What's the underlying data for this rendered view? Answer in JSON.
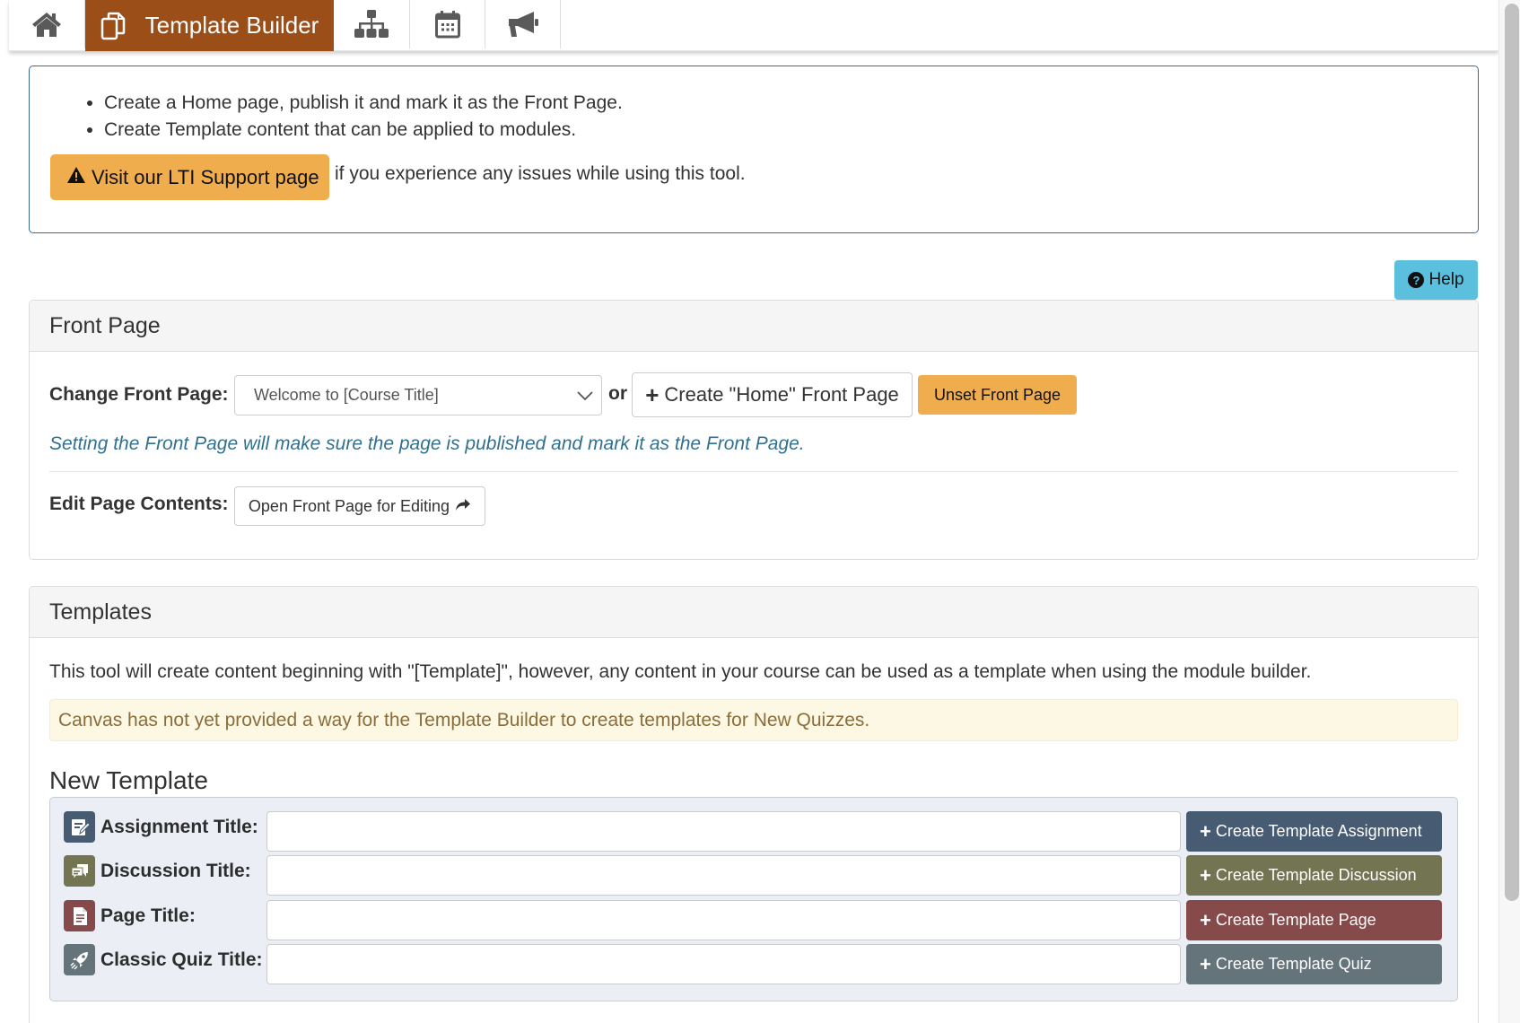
{
  "nav": {
    "tabs": [
      {
        "icon": "home-icon",
        "label": ""
      },
      {
        "icon": "copy-icon",
        "label": "Template Builder",
        "active": true
      },
      {
        "icon": "sitemap-icon",
        "label": ""
      },
      {
        "icon": "calendar-icon",
        "label": ""
      },
      {
        "icon": "bullhorn-icon",
        "label": ""
      }
    ],
    "active_color": "#9b4e18"
  },
  "info": {
    "bullets": [
      "Create a Home page, publish it and mark it as the Front Page.",
      "Create Template content that can be applied to modules."
    ],
    "support_button": "Visit our LTI Support page",
    "support_tail": "if you experience any issues while using this tool."
  },
  "help_button": "Help",
  "front_page": {
    "title": "Front Page",
    "change_label": "Change Front Page:",
    "select_value": "Welcome to [Course Title]",
    "or_text": "or",
    "create_home_button": "Create \"Home\" Front Page",
    "unset_button": "Unset Front Page",
    "note": "Setting the Front Page will make sure the page is published and mark it as the Front Page.",
    "edit_label": "Edit Page Contents:",
    "open_edit_button": "Open Front Page for Editing"
  },
  "templates": {
    "title": "Templates",
    "description": "This tool will create content beginning with \"[Template]\", however, any content in your course can be used as a template when using the module builder.",
    "warning": "Canvas has not yet provided a way for the Template Builder to create templates for New Quizzes.",
    "new_template_title": "New Template",
    "rows": [
      {
        "label": "Assignment Title:",
        "value": "",
        "button": "Create Template Assignment",
        "color": "#475c73",
        "icon": "assignment-icon"
      },
      {
        "label": "Discussion Title:",
        "value": "",
        "button": "Create Template Discussion",
        "color": "#737451",
        "icon": "discussion-icon"
      },
      {
        "label": "Page Title:",
        "value": "",
        "button": "Create Template Page",
        "color": "#874a4b",
        "icon": "page-icon"
      },
      {
        "label": "Classic Quiz Title:",
        "value": "",
        "button": "Create Template Quiz",
        "color": "#65737b",
        "icon": "quiz-rocket-icon"
      }
    ]
  }
}
